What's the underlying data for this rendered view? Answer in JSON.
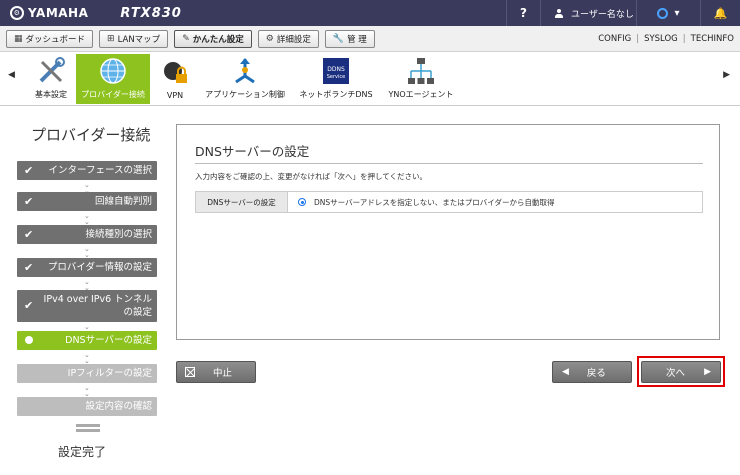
{
  "topbar": {
    "brand": "YAMAHA",
    "model": "RTX830",
    "help": "?",
    "user": "ユーザー名なし",
    "bell": "🔔"
  },
  "tabs": [
    {
      "label": "ダッシュボード",
      "icon": "dashboard-icon"
    },
    {
      "label": "LANマップ",
      "icon": "lanmap-icon"
    },
    {
      "label": "かんたん設定",
      "icon": "wand-icon",
      "active": true
    },
    {
      "label": "詳細設定",
      "icon": "gear-icon"
    },
    {
      "label": "管 理",
      "icon": "wrench-icon"
    }
  ],
  "tab_links": [
    "CONFIG",
    "SYSLOG",
    "TECHINFO"
  ],
  "functions": [
    {
      "label": "基本設定",
      "icon": "tools-icon"
    },
    {
      "label": "プロバイダー接続",
      "icon": "globe-icon",
      "active": true
    },
    {
      "label": "VPN",
      "icon": "vpn-lock-icon"
    },
    {
      "label": "アプリケーション制御",
      "icon": "app-control-icon"
    },
    {
      "label": "ネットボランチDNS",
      "icon": "dns-service-icon"
    },
    {
      "label": "YNOエージェント",
      "icon": "yno-network-icon"
    }
  ],
  "dns_badge": {
    "line1": "DDNS",
    "line2": "Service"
  },
  "stepper": {
    "title": "プロバイダー接続",
    "steps": [
      {
        "label": "インターフェースの選択",
        "state": "done"
      },
      {
        "label": "回線自動判別",
        "state": "done"
      },
      {
        "label": "接続種別の選択",
        "state": "done"
      },
      {
        "label": "プロバイダー情報の設定",
        "state": "done"
      },
      {
        "label": "IPv4 over IPv6 トンネル",
        "label2": "の設定",
        "state": "done"
      },
      {
        "label": "DNSサーバーの設定",
        "state": "current"
      },
      {
        "label": "IPフィルターの設定",
        "state": "todo"
      },
      {
        "label": "設定内容の確認",
        "state": "todo"
      }
    ],
    "done_label": "設定完了"
  },
  "panel": {
    "title": "DNSサーバーの設定",
    "description": "入力内容をご確認の上、変更がなければ「次へ」を押してください。",
    "setting_label": "DNSサーバーの設定",
    "setting_value": "DNSサーバーアドレスを指定しない、またはプロバイダーから自動取得"
  },
  "buttons": {
    "cancel": "中止",
    "back": "戻る",
    "next": "次へ"
  },
  "colors": {
    "accent_green": "#8dc21f",
    "topbar": "#3a3a5c",
    "highlight_red": "#e00000"
  }
}
